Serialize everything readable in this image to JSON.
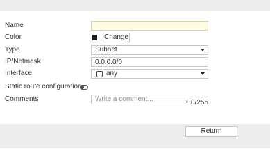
{
  "form": {
    "name": {
      "label": "Name",
      "value": ""
    },
    "color": {
      "label": "Color",
      "swatch_icon": "square-icon",
      "swatch_color": "#1a1a1a",
      "change_label": "Change"
    },
    "type": {
      "label": "Type",
      "value": "Subnet",
      "caret_icon": "caret-down-icon"
    },
    "ip_netmask": {
      "label": "IP/Netmask",
      "value": "0.0.0.0/0"
    },
    "interface": {
      "label": "Interface",
      "value": "any",
      "icon": "interface-square-icon",
      "caret_icon": "caret-down-icon"
    },
    "static_route": {
      "label": "Static route configuration",
      "enabled": false,
      "icon": "toggle-icon"
    },
    "comments": {
      "label": "Comments",
      "placeholder": "Write a comment...",
      "value": "",
      "counter": "0/255"
    }
  },
  "footer": {
    "return_label": "Return"
  },
  "colors": {
    "name_field_bg": "#fffbe3",
    "panel_bg": "#ededed"
  }
}
